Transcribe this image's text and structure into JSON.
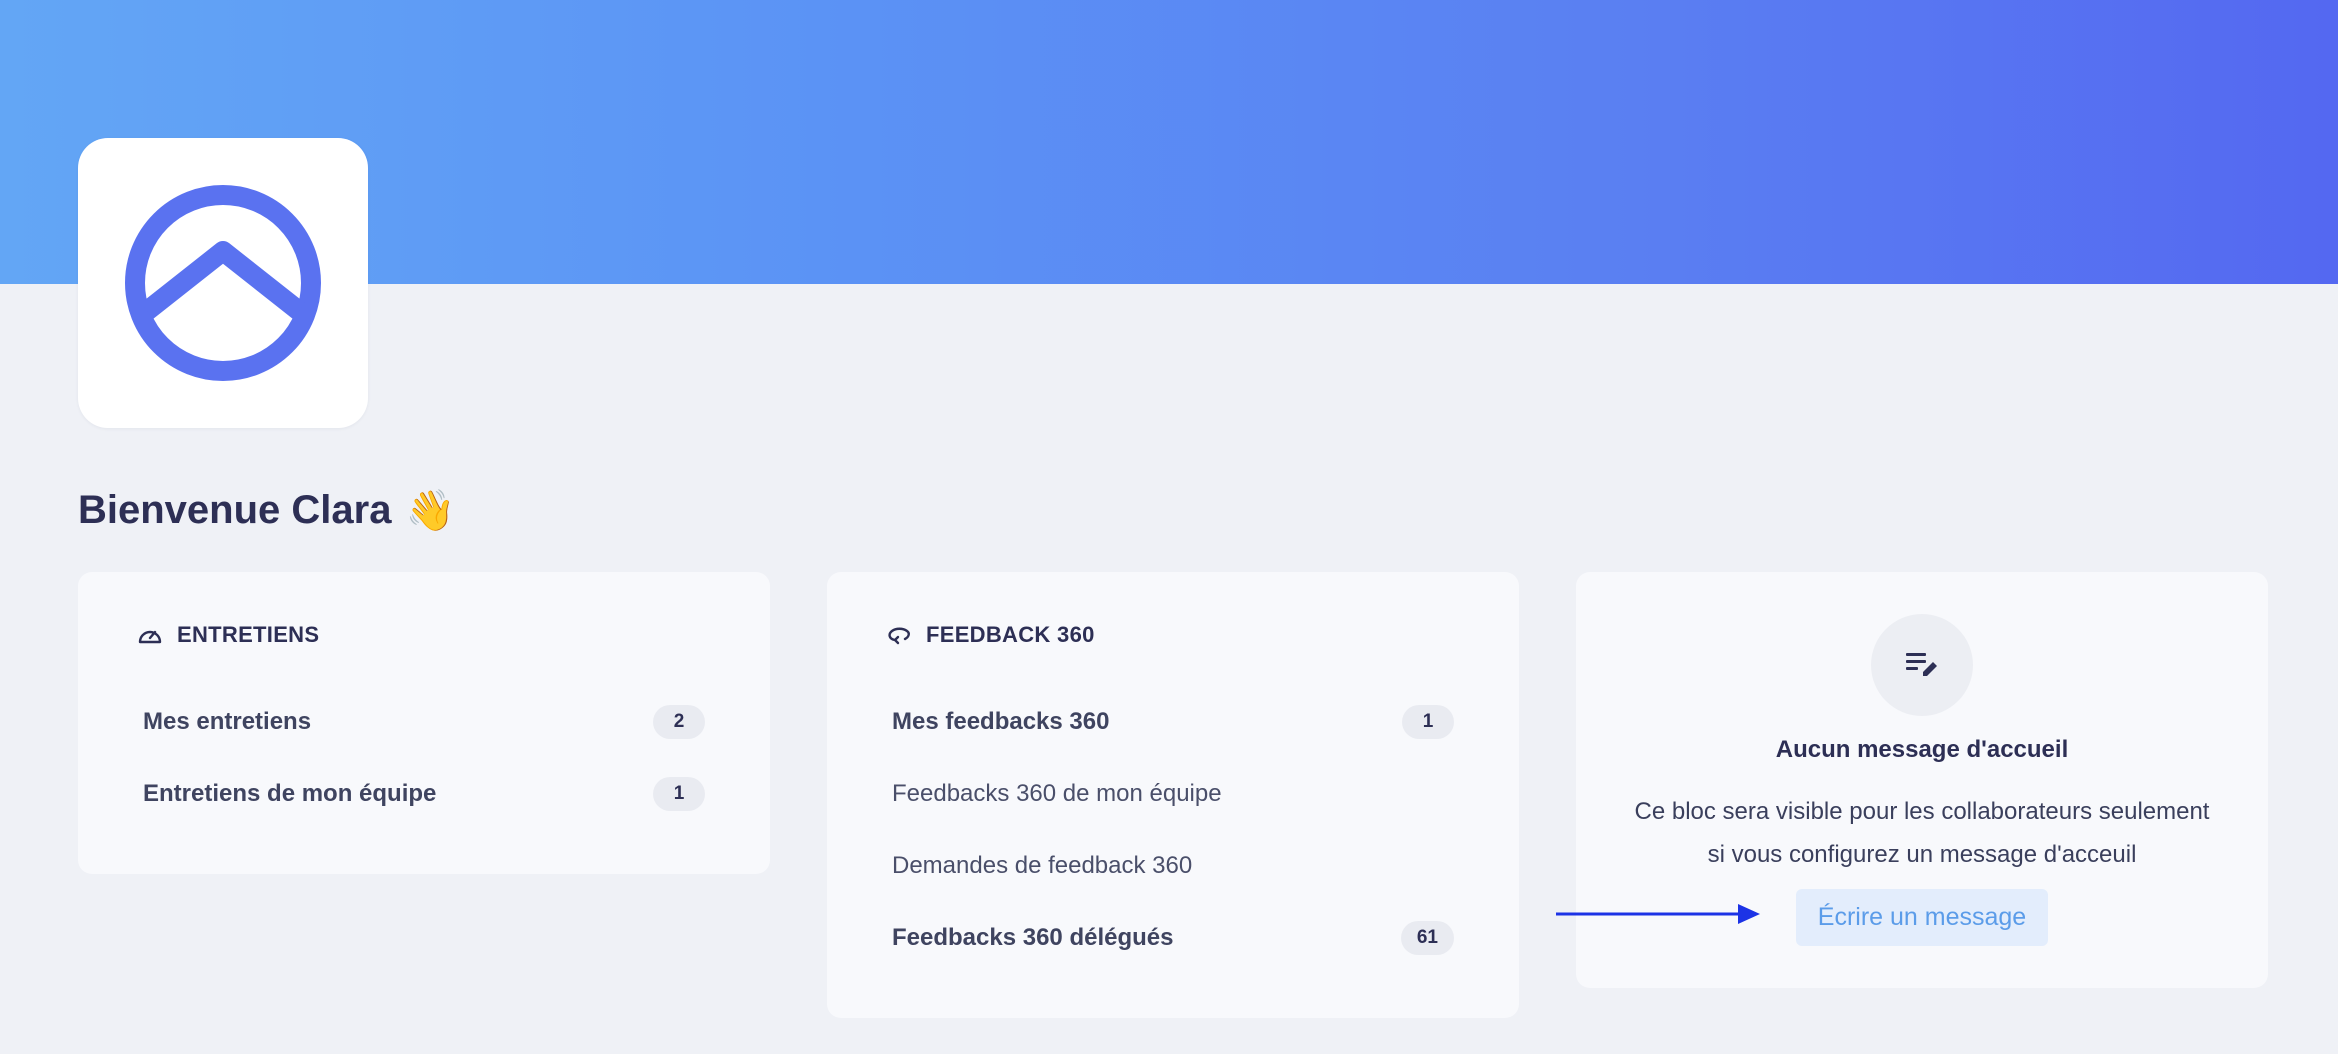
{
  "welcome": {
    "text": "Bienvenue Clara",
    "emoji": "👋"
  },
  "entretiens": {
    "title": "ENTRETIENS",
    "icon": "gauge-icon",
    "items": [
      {
        "label": "Mes entretiens",
        "count": "2"
      },
      {
        "label": "Entretiens de mon équipe",
        "count": "1"
      }
    ]
  },
  "feedback": {
    "title": "FEEDBACK 360",
    "icon": "loop-arrow-icon",
    "items": [
      {
        "label": "Mes feedbacks 360",
        "count": "1"
      },
      {
        "label": "Feedbacks 360 de mon équipe"
      },
      {
        "label": "Demandes de feedback 360"
      },
      {
        "label": "Feedbacks 360 délégués",
        "count": "61"
      }
    ]
  },
  "message": {
    "icon": "edit-note-icon",
    "title": "Aucun message d'accueil",
    "body_line1": "Ce bloc sera visible pour les collaborateurs seulement",
    "body_line2": "si vous configurez un message d'acceuil",
    "button_label": "Écrire un message"
  },
  "colors": {
    "banner_start": "#63a6f5",
    "banner_end": "#5468f1",
    "logo": "#5a72f0",
    "annotation_arrow": "#1c33e6",
    "button_text": "#5b9ce9"
  }
}
